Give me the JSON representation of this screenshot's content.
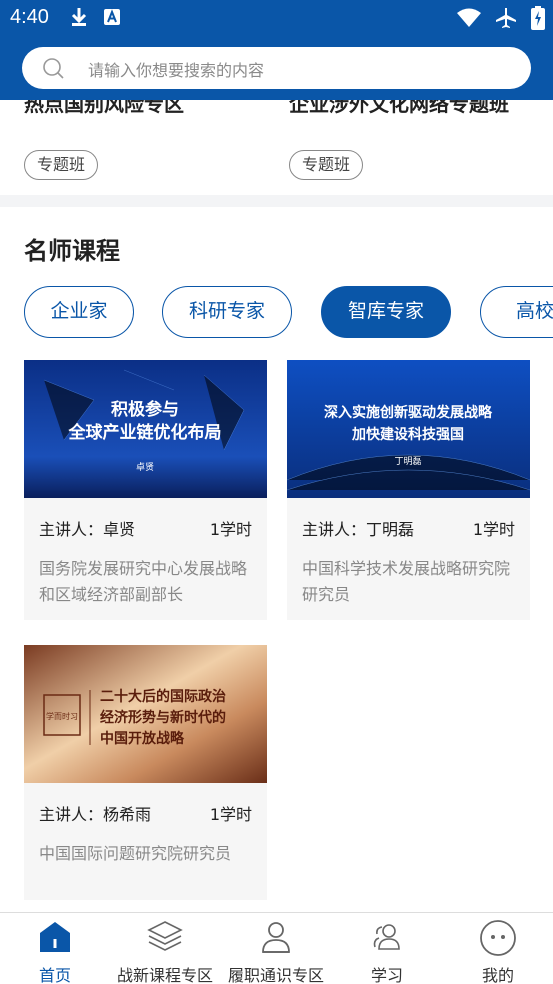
{
  "status_bar": {
    "time": "4:40"
  },
  "search": {
    "placeholder": "请输入你想要搜索的内容"
  },
  "special_classes": [
    {
      "title": "热点国别风险专区",
      "tag": "专题班"
    },
    {
      "title": "企业涉外文化网络专题班",
      "tag": "专题班"
    }
  ],
  "famous_teachers": {
    "title": "名师课程",
    "tabs": [
      {
        "label": "企业家",
        "active": false
      },
      {
        "label": "科研专家",
        "active": false
      },
      {
        "label": "智库专家",
        "active": true
      },
      {
        "label": "高校",
        "active": false
      }
    ],
    "courses": [
      {
        "thumb_lines": [
          "积极参与",
          "全球产业链优化布局"
        ],
        "thumb_name": "卓贤",
        "lecturer": "主讲人：卓贤",
        "hours": "1学时",
        "desc": "国务院发展研究中心发展战略和区域经济部副部长"
      },
      {
        "thumb_lines": [
          "深入实施创新驱动发展战略",
          "加快建设科技强国"
        ],
        "thumb_name": "丁明磊",
        "lecturer": "主讲人：丁明磊",
        "hours": "1学时",
        "desc": "中国科学技术发展战略研究院研究员"
      },
      {
        "thumb_lines": [
          "二十大后的国际政治",
          "经济形势与新时代的",
          "中国开放战略"
        ],
        "thumb_logo": "学而时习",
        "lecturer": "主讲人：杨希雨",
        "hours": "1学时",
        "desc": "中国国际问题研究院研究员"
      }
    ]
  },
  "bottom_nav": [
    {
      "label": "首页",
      "icon": "home-icon",
      "active": true
    },
    {
      "label": "战新课程专区",
      "icon": "layers-icon",
      "active": false
    },
    {
      "label": "履职通识专区",
      "icon": "person-icon",
      "active": false
    },
    {
      "label": "学习",
      "icon": "study-people-icon",
      "active": false
    },
    {
      "label": "我的",
      "icon": "smiley-icon",
      "active": false
    }
  ],
  "colors": {
    "primary": "#0a56a8",
    "muted_text": "#888888"
  }
}
